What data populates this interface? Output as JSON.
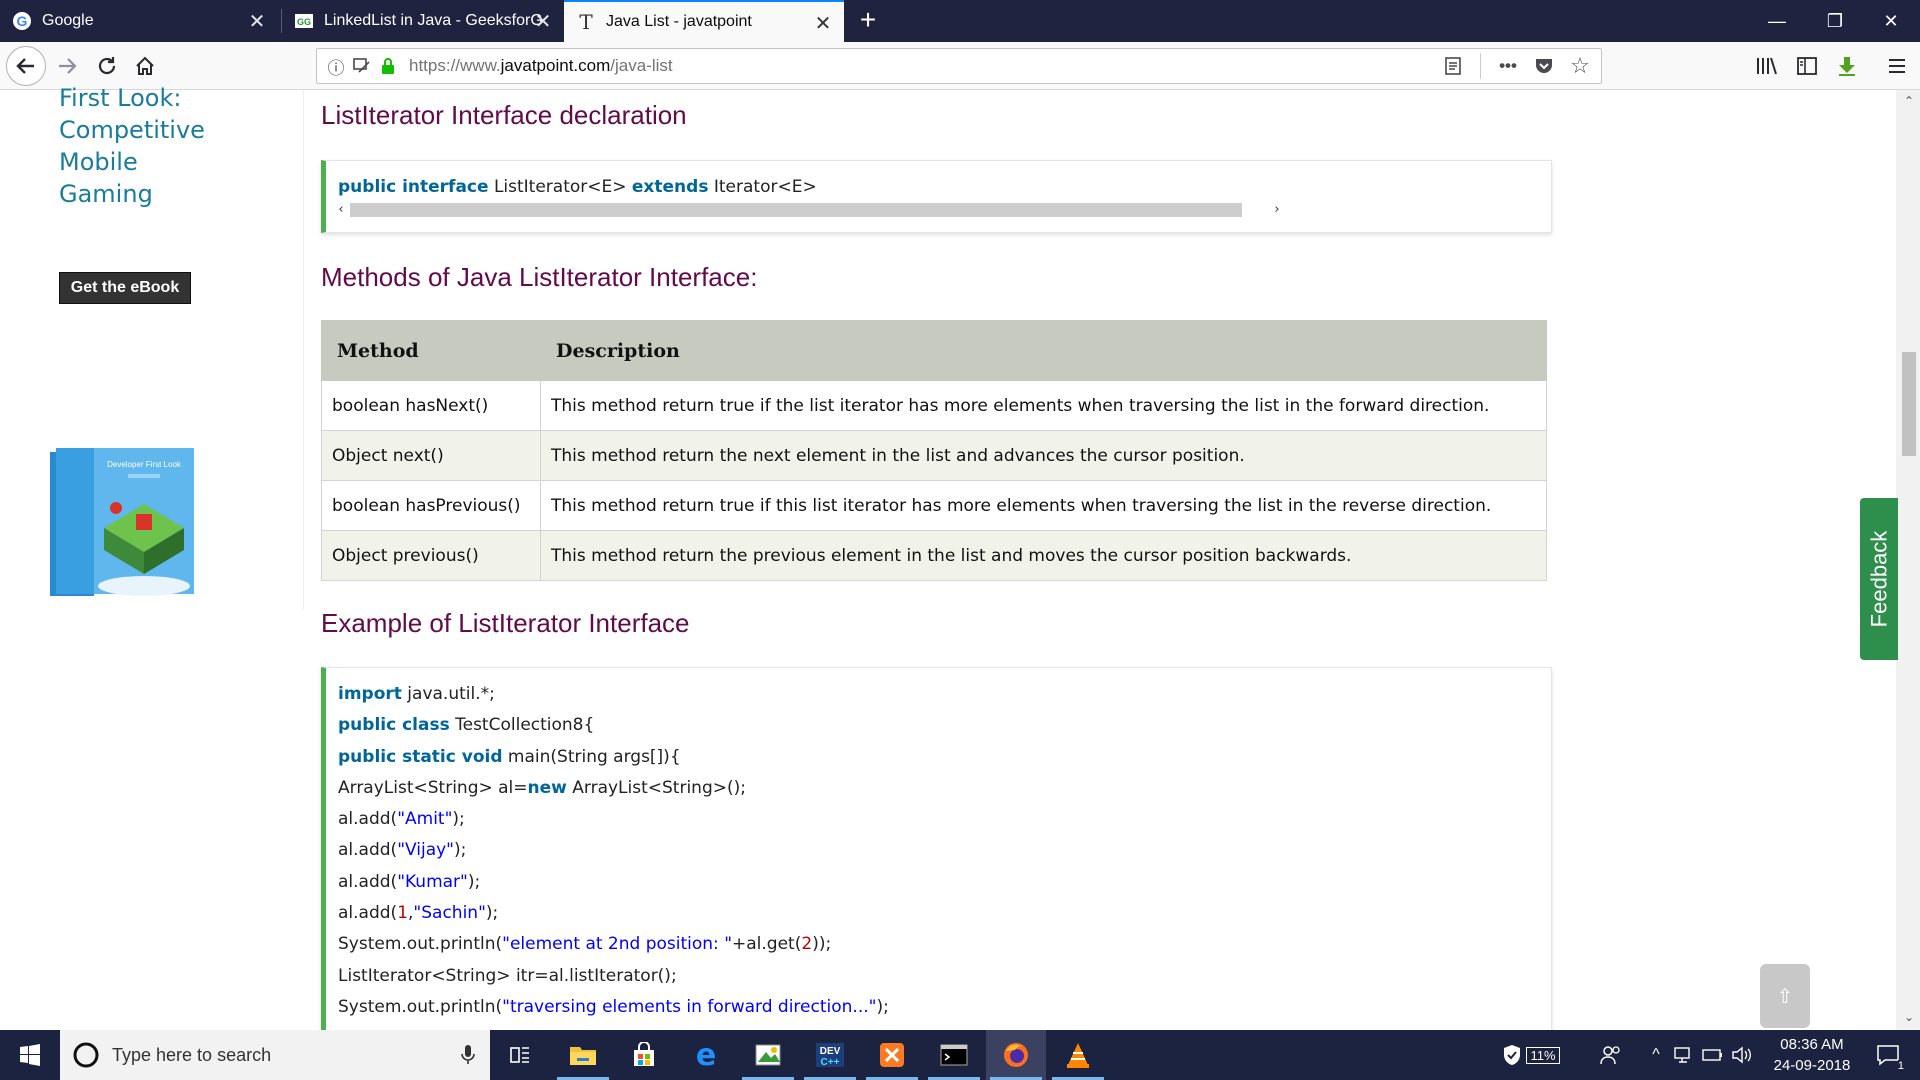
{
  "browser": {
    "tabs": [
      {
        "title": "Google",
        "favicon": "google-g-icon"
      },
      {
        "title": "LinkedList in Java - GeeksforGe",
        "favicon": "geeksforgeeks-icon"
      },
      {
        "title": "Java List - javatpoint",
        "favicon": "javatpoint-t-icon"
      }
    ],
    "url": {
      "scheme": "https://www.",
      "host": "javatpoint.com",
      "path": "/java-list"
    }
  },
  "sidebar_ad": {
    "title_lines": [
      "First Look:",
      "Competitive",
      "Mobile",
      "Gaming"
    ],
    "button_label": "Get the eBook",
    "book_cover_text": "Developer First Look"
  },
  "content": {
    "section1_title": "ListIterator Interface declaration",
    "declaration": {
      "kw1": "public interface",
      "t1": " ListIterator<E> ",
      "kw2": "extends",
      "t2": " Iterator<E>"
    },
    "section2_title": "Methods of Java ListIterator Interface:",
    "table": {
      "headers": [
        "Method",
        "Description"
      ],
      "rows": [
        [
          "boolean hasNext()",
          "This method return true if the list iterator has more elements when traversing the list in the forward direction."
        ],
        [
          "Object next()",
          "This method return the next element in the list and advances the cursor position."
        ],
        [
          "boolean hasPrevious()",
          "This method return true if this list iterator has more elements when traversing the list in the reverse direction."
        ],
        [
          "Object previous()",
          "This method return the previous element in the list and moves the cursor position backwards."
        ]
      ]
    },
    "section3_title": "Example of ListIterator Interface",
    "code": {
      "l1": {
        "kw": "import",
        "t": " java.util.*;"
      },
      "l2": {
        "kw": "public class",
        "t": " TestCollection8{"
      },
      "l3": {
        "kw": "public static void",
        "t": " main(String args[]){"
      },
      "l4": {
        "a": "ArrayList<String> al=",
        "kw": "new",
        "b": " ArrayList<String>();"
      },
      "l5": {
        "a": "al.add(",
        "s": "\"Amit\"",
        "b": ");"
      },
      "l6": {
        "a": "al.add(",
        "s": "\"Vijay\"",
        "b": ");"
      },
      "l7": {
        "a": "al.add(",
        "s": "\"Kumar\"",
        "b": ");"
      },
      "l8": {
        "a": "al.add(",
        "n": "1",
        "c": ",",
        "s": "\"Sachin\"",
        "b": ");"
      },
      "l9": {
        "a": "System.out.println(",
        "s": "\"element at 2nd position: \"",
        "c": "+al.get(",
        "n": "2",
        "b": "));"
      },
      "l10": {
        "t": "ListIterator<String> itr=al.listIterator();"
      },
      "l11": {
        "a": "System.out.println(",
        "s": "\"traversing elements in forward direction...\"",
        "b": ");"
      }
    }
  },
  "feedback_label": "Feedback",
  "taskbar": {
    "search_placeholder": "Type here to search",
    "battery": "11%",
    "time": "08:36 AM",
    "date": "24-09-2018",
    "notification_count": "1"
  }
}
